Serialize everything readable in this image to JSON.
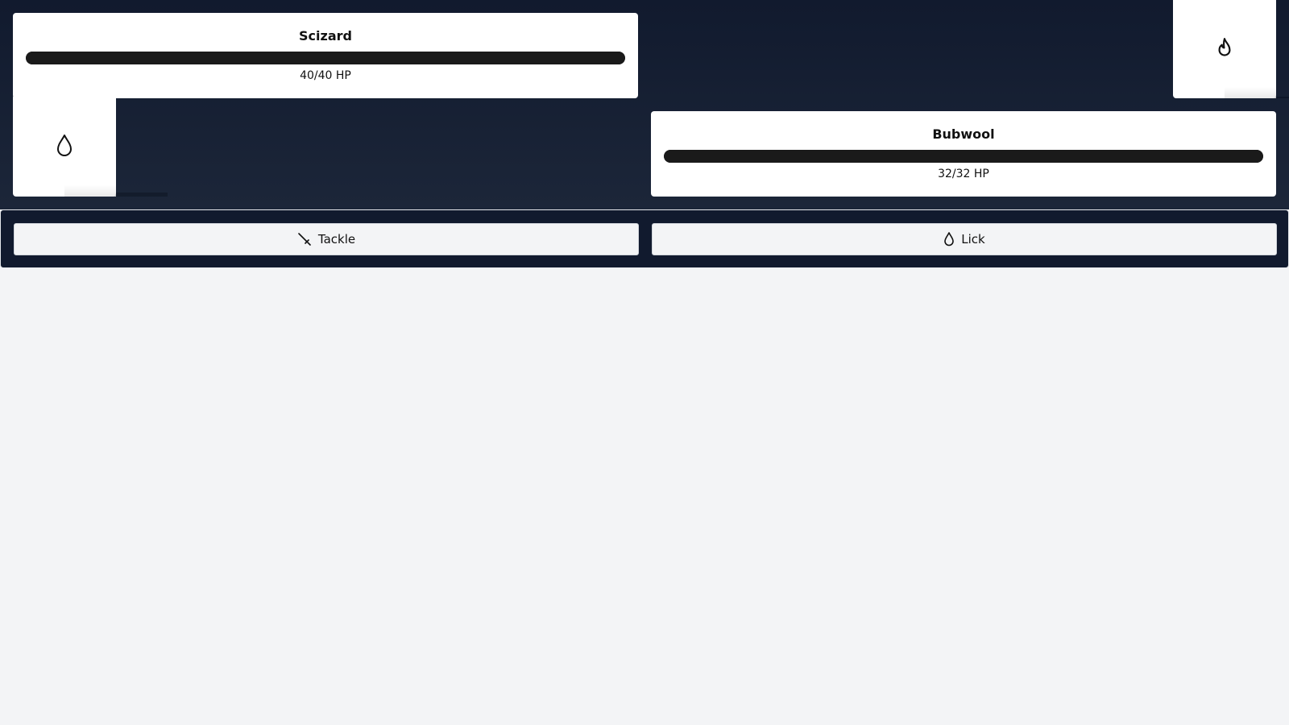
{
  "enemy": {
    "name": "Scizard",
    "hp_text": "40/40 HP",
    "hp_fraction": 1.0,
    "type_icon": "flame-icon"
  },
  "player": {
    "name": "Bubwool",
    "hp_text": "32/32 HP",
    "hp_fraction": 1.0,
    "type_icon": "droplet-icon"
  },
  "moves": [
    {
      "label": "Tackle",
      "icon": "sword-icon"
    },
    {
      "label": "Lick",
      "icon": "droplet-icon"
    }
  ],
  "colors": {
    "background": "#f3f4f6",
    "battle_top": "#111a2e",
    "battle_bottom": "#1c2639",
    "card": "#ffffff",
    "hp_bar": "#1a1a1a",
    "button": "#f3f4f6"
  }
}
